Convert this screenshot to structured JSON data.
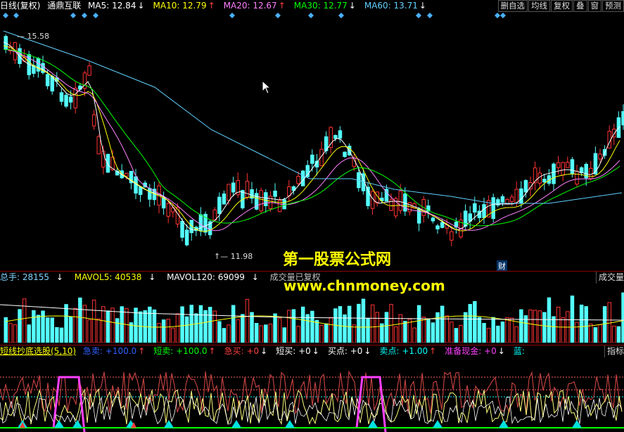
{
  "header": {
    "period": "日线(复权)",
    "stock": "通鼎互联",
    "ma": [
      {
        "label": "MA5: 12.84",
        "arrow": "↓",
        "color": "#ffffff"
      },
      {
        "label": "MA10: 12.79",
        "arrow": "↑",
        "color": "#ffff00"
      },
      {
        "label": "MA20: 12.67",
        "arrow": "↑",
        "color": "#ff80ff"
      },
      {
        "label": "MA30: 12.77",
        "arrow": "↓",
        "color": "#00ff00"
      },
      {
        "label": "MA60: 13.71",
        "arrow": "↓",
        "color": "#60d0ff"
      }
    ],
    "buttons": [
      "删自选",
      "均线",
      "复权",
      "叠",
      "窗",
      "预测"
    ]
  },
  "price": {
    "high_label": "15.58",
    "low_label": "11.98",
    "cai_badge": "财"
  },
  "volume": {
    "total": "总手: 28155",
    "total_arrow": "↓",
    "mavol5": "MAVOL5: 40538",
    "mavol5_arrow": "↓",
    "mavol120": "MAVOL120: 69099",
    "mavol120_arrow": "↓",
    "note": "成交量已复权",
    "right_note": "成交量"
  },
  "indicator": {
    "name": "短线抄底选股(5,10)",
    "items": [
      {
        "label": "急卖: +100.0",
        "arrow": "↑",
        "color": "#3060ff"
      },
      {
        "label": "短卖: +100.0",
        "arrow": "↑",
        "color": "#00ff00"
      },
      {
        "label": "急买: +0",
        "arrow": "↓",
        "color": "#ff4040"
      },
      {
        "label": "短买: +0",
        "arrow": "↓",
        "color": "#ffffff"
      },
      {
        "label": "买点: +0",
        "arrow": "↓",
        "color": "#ffffff"
      },
      {
        "label": "卖点: +1.00",
        "arrow": "↑",
        "color": "#00ffff"
      },
      {
        "label": "准备现金: +0",
        "arrow": "↓",
        "color": "#ff40ff"
      },
      {
        "label": "蓝:",
        "arrow": "",
        "color": "#00ffff"
      }
    ],
    "right_note": "指标"
  },
  "watermark": {
    "line1": "第一股票公式网",
    "line2": "www.chnmoney.com"
  },
  "colors": {
    "up": "#ff3232",
    "down": "#54ffff",
    "ma5": "#ffffff",
    "ma10": "#ffff00",
    "ma20": "#ff80ff",
    "ma30": "#00ff00",
    "ma60": "#60d0ff"
  }
}
